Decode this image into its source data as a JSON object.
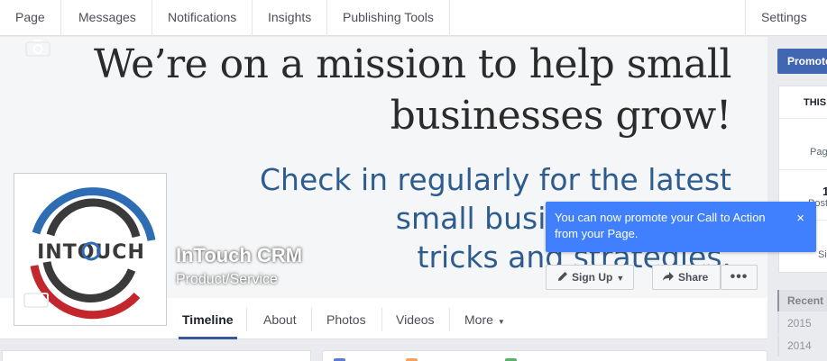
{
  "topnav": {
    "items": [
      "Page",
      "Messages",
      "Notifications",
      "Insights",
      "Publishing Tools"
    ],
    "settings": "Settings"
  },
  "cover": {
    "headline_line1": "We’re on a mission to help small",
    "headline_line2": "businesses grow!",
    "sub_line1": "Check in regularly for the latest",
    "sub_line2": "small business",
    "sub_line3": "tricks and strategies."
  },
  "profile": {
    "logo_text": "INTOUCH",
    "name": "InTouch CRM",
    "category": "Product/Service"
  },
  "tooltip": {
    "text": "You can now promote your Call to Action from your Page.",
    "close": "×"
  },
  "buttons": {
    "signup": "Sign Up",
    "share": "Share",
    "more": "•••"
  },
  "tabs": [
    "Timeline",
    "About",
    "Photos",
    "Videos",
    "More"
  ],
  "sidebar": {
    "promote": "Promote",
    "card_header": "THIS",
    "page_label": "Page",
    "number": "1",
    "posts_label": "Post",
    "sign_label": "Sig"
  },
  "years": {
    "recent": "Recent",
    "y2015": "2015",
    "y2014": "2014"
  },
  "colors": {
    "accent": "#4267b2",
    "tooltip": "#4080ff",
    "headline": "#2b2b2b",
    "subline": "#2e5c8f",
    "logo_blue": "#2e6db4",
    "logo_red": "#c4262e"
  }
}
